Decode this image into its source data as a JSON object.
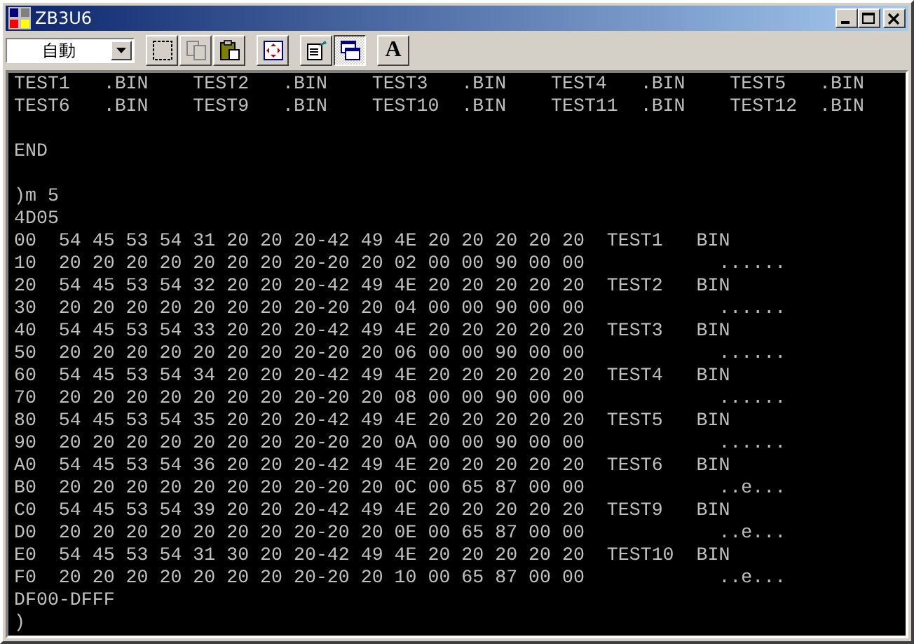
{
  "window": {
    "title": "ZB3U6"
  },
  "toolbar": {
    "font_size": {
      "value": "自動"
    },
    "buttons": [
      {
        "kind": "mark",
        "disabled": false,
        "pressed": false
      },
      {
        "kind": "copy",
        "disabled": true,
        "pressed": false
      },
      {
        "kind": "paste",
        "disabled": false,
        "pressed": false
      },
      {
        "kind": "fullscreen",
        "disabled": false,
        "pressed": false
      },
      {
        "kind": "properties",
        "disabled": false,
        "pressed": false
      },
      {
        "kind": "background",
        "disabled": false,
        "pressed": true
      },
      {
        "kind": "font",
        "label": "A",
        "disabled": false,
        "pressed": false
      }
    ]
  },
  "console": {
    "lines": [
      {
        "kind": "text",
        "text": "TEST1   .BIN    TEST2   .BIN    TEST3   .BIN    TEST4   .BIN    TEST5   .BIN"
      },
      {
        "kind": "text",
        "text": "TEST6   .BIN    TEST9   .BIN    TEST10  .BIN    TEST11  .BIN    TEST12  .BIN"
      },
      {
        "kind": "blank"
      },
      {
        "kind": "text",
        "text": "END"
      },
      {
        "kind": "blank"
      },
      {
        "kind": "text",
        "text": ")m 5"
      },
      {
        "kind": "text",
        "text": "4D05"
      },
      {
        "kind": "text",
        "text": "00  54 45 53 54 31 20 20 20-42 49 4E 20 20 20 20 20  TEST1   BIN"
      },
      {
        "kind": "text",
        "text": "10  20 20 20 20 20 20 20 20-20 20 02 00 00 90 00 00            ......"
      },
      {
        "kind": "text",
        "text": "20  54 45 53 54 32 20 20 20-42 49 4E 20 20 20 20 20  TEST2   BIN"
      },
      {
        "kind": "text",
        "text": "30  20 20 20 20 20 20 20 20-20 20 04 00 00 90 00 00            ......"
      },
      {
        "kind": "text",
        "text": "40  54 45 53 54 33 20 20 20-42 49 4E 20 20 20 20 20  TEST3   BIN"
      },
      {
        "kind": "text",
        "text": "50  20 20 20 20 20 20 20 20-20 20 06 00 00 90 00 00            ......"
      },
      {
        "kind": "text",
        "text": "60  54 45 53 54 34 20 20 20-42 49 4E 20 20 20 20 20  TEST4   BIN"
      },
      {
        "kind": "text",
        "text": "70  20 20 20 20 20 20 20 20-20 20 08 00 00 90 00 00            ......"
      },
      {
        "kind": "text",
        "text": "80  54 45 53 54 35 20 20 20-42 49 4E 20 20 20 20 20  TEST5   BIN"
      },
      {
        "kind": "text",
        "text": "90  20 20 20 20 20 20 20 20-20 20 0A 00 00 90 00 00            ......"
      },
      {
        "kind": "text",
        "text": "A0  54 45 53 54 36 20 20 20-42 49 4E 20 20 20 20 20  TEST6   BIN"
      },
      {
        "kind": "text",
        "text": "B0  20 20 20 20 20 20 20 20-20 20 0C 00 65 87 00 00            ..e..."
      },
      {
        "kind": "text",
        "text": "C0  54 45 53 54 39 20 20 20-42 49 4E 20 20 20 20 20  TEST9   BIN"
      },
      {
        "kind": "text",
        "text": "D0  20 20 20 20 20 20 20 20-20 20 0E 00 65 87 00 00            ..e..."
      },
      {
        "kind": "text",
        "text": "E0  54 45 53 54 31 30 20 20-42 49 4E 20 20 20 20 20  TEST10  BIN"
      },
      {
        "kind": "text",
        "text": "F0  20 20 20 20 20 20 20 20-20 20 10 00 65 87 00 00            ..e..."
      },
      {
        "kind": "text",
        "text": "DF00-DFFF"
      },
      {
        "kind": "text",
        "text": ")"
      }
    ]
  }
}
